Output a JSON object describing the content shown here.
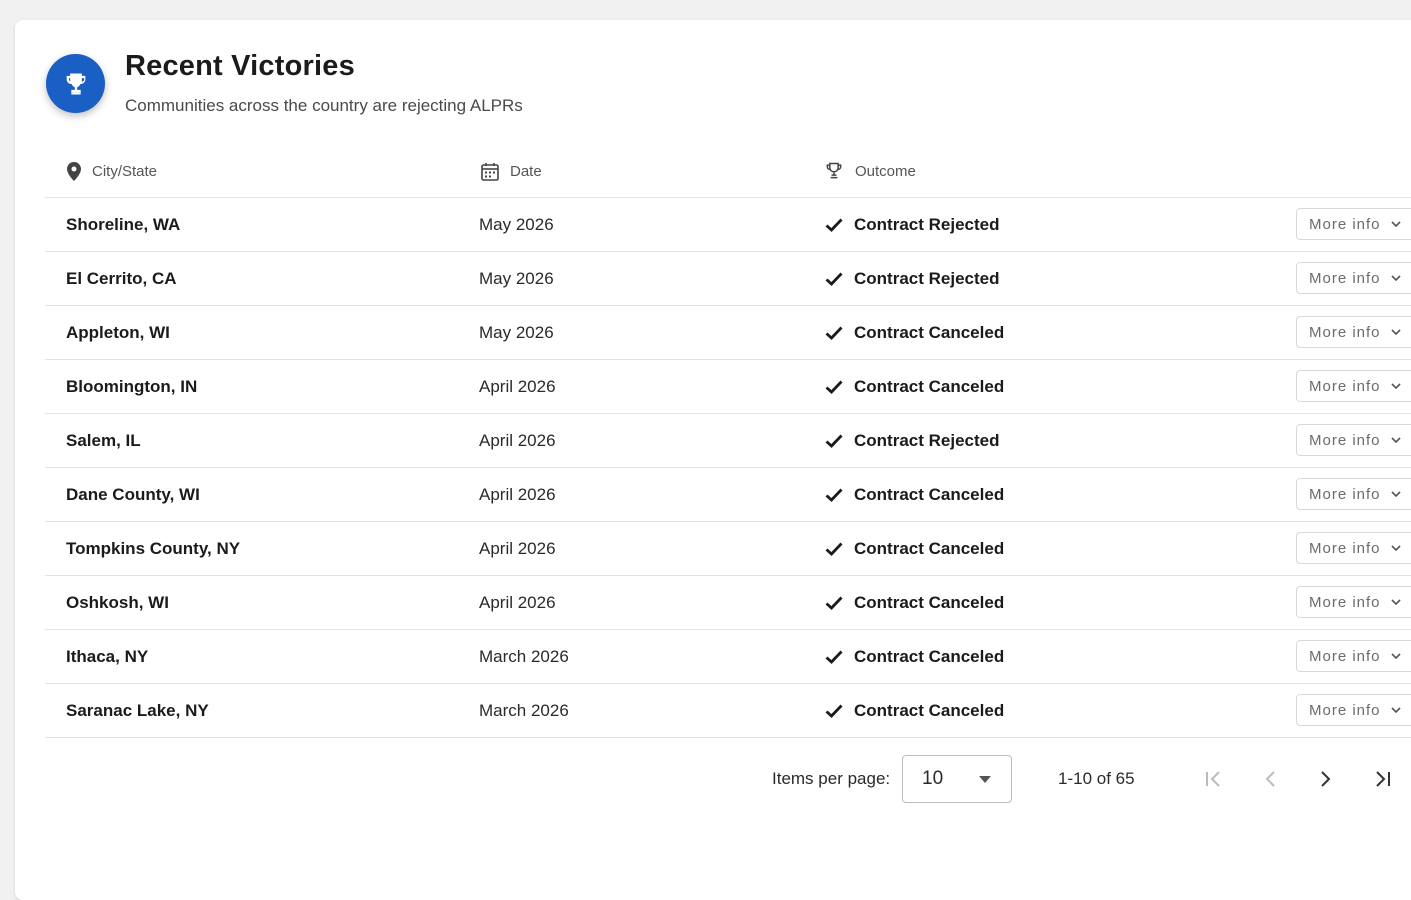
{
  "header": {
    "title": "Recent Victories",
    "subtitle": "Communities across the country are rejecting ALPRs",
    "icon": "trophy-icon",
    "icon_bg_color": "#1a5fc4"
  },
  "table": {
    "columns": [
      {
        "label": "City/State",
        "icon": "location-pin-icon"
      },
      {
        "label": "Date",
        "icon": "calendar-icon"
      },
      {
        "label": "Outcome",
        "icon": "trophy-icon"
      }
    ],
    "rows": [
      {
        "city": "Shoreline, WA",
        "date": "May 2026",
        "outcome": "Contract Rejected",
        "action": "More info"
      },
      {
        "city": "El Cerrito, CA",
        "date": "May 2026",
        "outcome": "Contract Rejected",
        "action": "More info"
      },
      {
        "city": "Appleton, WI",
        "date": "May 2026",
        "outcome": "Contract Canceled",
        "action": "More info"
      },
      {
        "city": "Bloomington, IN",
        "date": "April 2026",
        "outcome": "Contract Canceled",
        "action": "More info"
      },
      {
        "city": "Salem, IL",
        "date": "April 2026",
        "outcome": "Contract Rejected",
        "action": "More info"
      },
      {
        "city": "Dane County, WI",
        "date": "April 2026",
        "outcome": "Contract Canceled",
        "action": "More info"
      },
      {
        "city": "Tompkins County, NY",
        "date": "April 2026",
        "outcome": "Contract Canceled",
        "action": "More info"
      },
      {
        "city": "Oshkosh, WI",
        "date": "April 2026",
        "outcome": "Contract Canceled",
        "action": "More info"
      },
      {
        "city": "Ithaca, NY",
        "date": "March 2026",
        "outcome": "Contract Canceled",
        "action": "More info"
      },
      {
        "city": "Saranac Lake, NY",
        "date": "March 2026",
        "outcome": "Contract Canceled",
        "action": "More info"
      }
    ]
  },
  "pagination": {
    "items_per_page_label": "Items per page:",
    "items_per_page_value": "10",
    "range_label": "1-10 of 65"
  }
}
